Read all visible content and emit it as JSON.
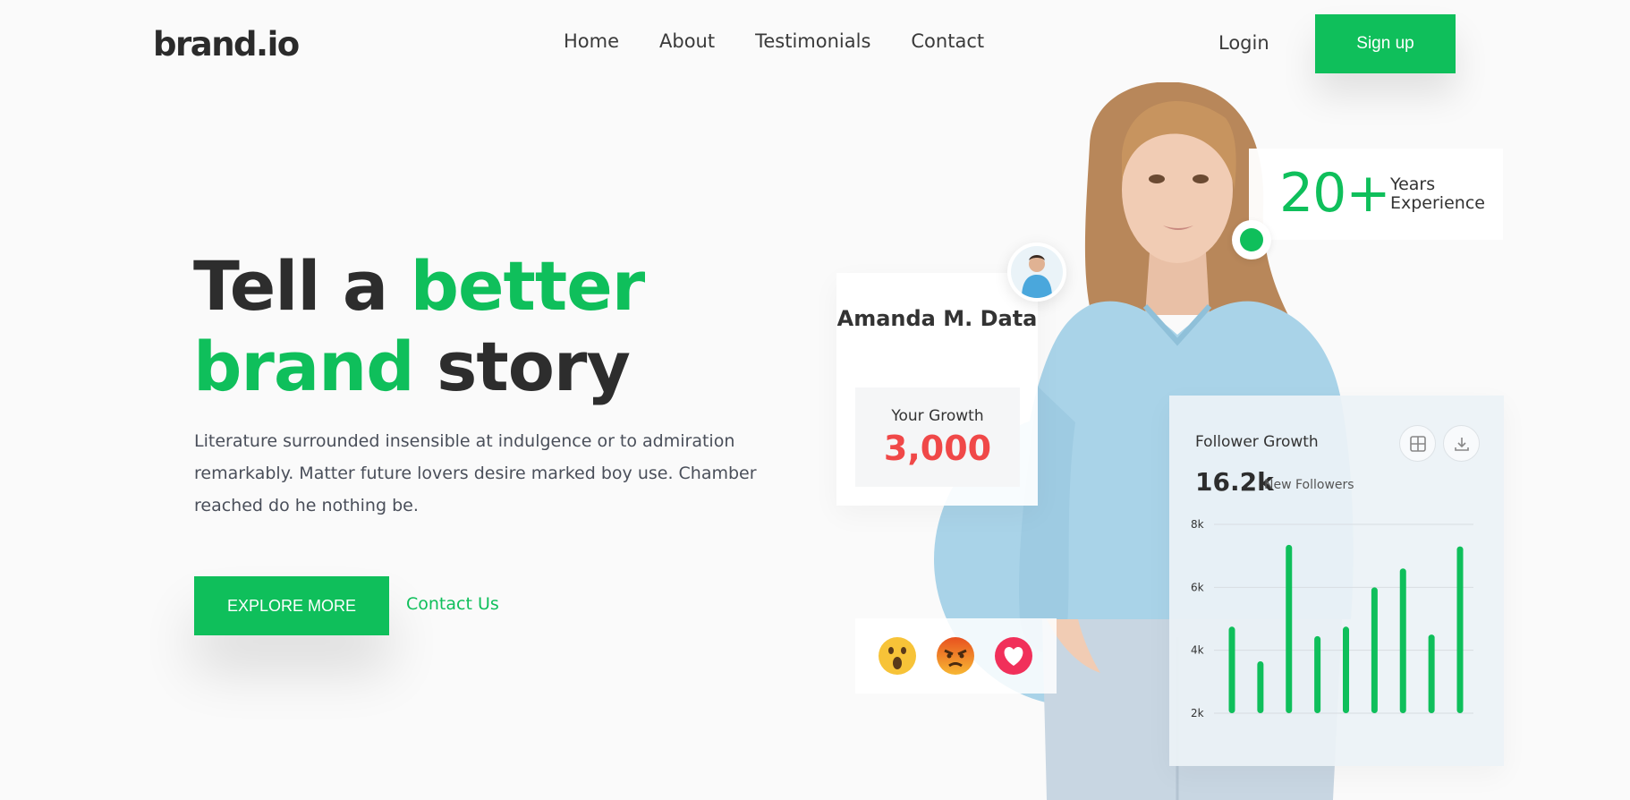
{
  "header": {
    "logo": "brand.io",
    "nav": [
      "Home",
      "About",
      "Testimonials",
      "Contact"
    ],
    "login_label": "Login",
    "signup_label": "Sign up"
  },
  "hero": {
    "title_part1": "Tell a ",
    "title_part2": "better",
    "title_part3": "brand",
    "title_part4": " story",
    "description": "Literature surrounded insensible at indulgence or to admiration remarkably. Matter future lovers desire marked boy use. Chamber reached do he nothing be.",
    "explore_label": "EXPLORE MORE",
    "contact_label": "Contact Us"
  },
  "profile": {
    "name": "Amanda M. Data",
    "growth_label": "Your Growth",
    "growth_value": "3,000"
  },
  "experience": {
    "value": "20+",
    "label_line1": "Years",
    "label_line2": "Experience"
  },
  "reactions": [
    "wow-emoji-icon",
    "angry-emoji-icon",
    "heart-icon"
  ],
  "colors": {
    "accent": "#0fbf5b",
    "growth": "#f04848",
    "text": "#2d2d2d"
  },
  "chart_card": {
    "title": "Follower Growth",
    "total": "16.2k",
    "total_label": "New Followers"
  },
  "chart_data": {
    "type": "bar",
    "title": "Follower Growth",
    "y_tick_labels": [
      "8k",
      "6k",
      "4k",
      "2k"
    ],
    "y_ticks": [
      8,
      6,
      4,
      2
    ],
    "ylim": [
      2,
      8
    ],
    "values": [
      4.75,
      3.65,
      7.35,
      4.45,
      4.75,
      6.0,
      6.6,
      4.5,
      7.3
    ],
    "grid": true,
    "color": "#0fbf5b"
  }
}
